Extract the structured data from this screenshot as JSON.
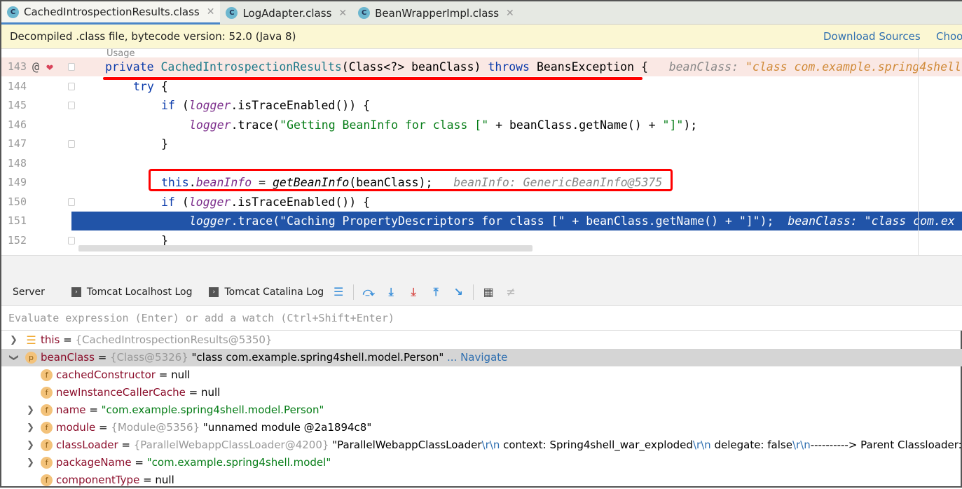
{
  "tabs": [
    {
      "label": "CachedIntrospectionResults.class",
      "active": true
    },
    {
      "label": "LogAdapter.class"
    },
    {
      "label": "BeanWrapperImpl.class"
    }
  ],
  "banner": {
    "text": "Decompiled .class file, bytecode version: 52.0 (Java 8)",
    "download_sources": "Download Sources",
    "choose": "Choo"
  },
  "usage_hint": "Usage",
  "code": [
    {
      "n": "143",
      "indent": 0,
      "hl": true,
      "tokens": [
        [
          "kw",
          "private "
        ],
        [
          "fn",
          "CachedIntrospectionResults"
        ],
        [
          "",
          "(Class<?> beanClass) "
        ],
        [
          "kw",
          "throws "
        ],
        [
          "",
          "BeansException {"
        ],
        [
          "hint",
          "   beanClass: "
        ],
        [
          "hintv",
          "\"class com.example.spring4shell"
        ]
      ]
    },
    {
      "n": "144",
      "indent": 1,
      "tokens": [
        [
          "kw",
          "try "
        ],
        [
          "",
          "{"
        ]
      ]
    },
    {
      "n": "145",
      "indent": 2,
      "tokens": [
        [
          "kw",
          "if "
        ],
        [
          "",
          "("
        ],
        [
          "lg",
          "logger"
        ],
        [
          "",
          ".isTraceEnabled()) {"
        ]
      ]
    },
    {
      "n": "146",
      "indent": 3,
      "tokens": [
        [
          "lg",
          "logger"
        ],
        [
          "",
          ".trace("
        ],
        [
          "str",
          "\"Getting BeanInfo for class [\""
        ],
        [
          "",
          " + beanClass.getName() + "
        ],
        [
          "str",
          "\"]\""
        ],
        [
          "",
          ");"
        ]
      ]
    },
    {
      "n": "147",
      "indent": 2,
      "tokens": [
        [
          "",
          "}"
        ]
      ]
    },
    {
      "n": "148",
      "indent": 0,
      "tokens": []
    },
    {
      "n": "149",
      "indent": 2,
      "tokens": [
        [
          "kw",
          "this"
        ],
        [
          "",
          "."
        ],
        [
          "lg",
          "beanInfo"
        ],
        [
          "",
          " = "
        ],
        [
          "it",
          "getBeanInfo"
        ],
        [
          "",
          "(beanClass);"
        ],
        [
          "hint",
          "   beanInfo: GenericBeanInfo@5375"
        ]
      ]
    },
    {
      "n": "150",
      "indent": 2,
      "tokens": [
        [
          "kw",
          "if "
        ],
        [
          "",
          "("
        ],
        [
          "lg",
          "logger"
        ],
        [
          "",
          ".isTraceEnabled()) {"
        ]
      ]
    },
    {
      "n": "151",
      "indent": 3,
      "sel": true,
      "tokens": [
        [
          "lg",
          "logger"
        ],
        [
          "",
          ".trace("
        ],
        [
          "str",
          "\"Caching PropertyDescriptors for class [\""
        ],
        [
          "",
          " + beanClass.getName() + "
        ],
        [
          "str",
          "\"]\""
        ],
        [
          "",
          ");"
        ],
        [
          "hint",
          "  beanClass: \"class com.ex"
        ]
      ]
    },
    {
      "n": "152",
      "indent": 2,
      "tokens": [
        [
          "",
          "}"
        ]
      ]
    }
  ],
  "toolbar": {
    "server": "Server",
    "localhost_log": "Tomcat Localhost Log",
    "catalina_log": "Tomcat Catalina Log"
  },
  "eval_placeholder": "Evaluate expression (Enter) or add a watch (Ctrl+Shift+Enter)",
  "variables": [
    {
      "level": 0,
      "arrow": "›",
      "icon": "list",
      "name": "this",
      "parts": [
        [
          "gr",
          "{CachedIntrospectionResults@5350}"
        ]
      ]
    },
    {
      "level": 0,
      "arrow": "⌄",
      "icon": "p",
      "name": "beanClass",
      "selected": true,
      "parts": [
        [
          "gr",
          "{Class@5326} "
        ],
        [
          "",
          "\"class com.example.spring4shell.model.Person\""
        ],
        [
          "bl",
          " ... Navigate"
        ]
      ]
    },
    {
      "level": 1,
      "arrow": "",
      "icon": "f",
      "name": "cachedConstructor",
      "parts": [
        [
          "",
          "null"
        ]
      ]
    },
    {
      "level": 1,
      "arrow": "",
      "icon": "f",
      "name": "newInstanceCallerCache",
      "parts": [
        [
          "",
          "null"
        ]
      ]
    },
    {
      "level": 1,
      "arrow": "›",
      "icon": "f",
      "name": "name",
      "parts": [
        [
          "gs",
          "\"com.example.spring4shell.model.Person\""
        ]
      ]
    },
    {
      "level": 1,
      "arrow": "›",
      "icon": "f",
      "name": "module",
      "parts": [
        [
          "gr",
          "{Module@5356} "
        ],
        [
          "",
          "\"unnamed module @2a1894c8\""
        ]
      ]
    },
    {
      "level": 1,
      "arrow": "›",
      "icon": "f",
      "name": "classLoader",
      "parts": [
        [
          "gr",
          "{ParallelWebappClassLoader@4200} "
        ],
        [
          "",
          "\"ParallelWebappClassLoader"
        ],
        [
          "esc",
          "\\r\\n"
        ],
        [
          "",
          "  context: Spring4shell_war_exploded"
        ],
        [
          "esc",
          "\\r\\n"
        ],
        [
          "",
          "  delegate: false"
        ],
        [
          "esc",
          "\\r\\n"
        ],
        [
          "",
          "----------> Parent Classloader:"
        ],
        [
          "esc",
          "\\r\\n"
        ],
        [
          "",
          "j"
        ]
      ]
    },
    {
      "level": 1,
      "arrow": "›",
      "icon": "f",
      "name": "packageName",
      "parts": [
        [
          "gs",
          "\"com.example.spring4shell.model\""
        ]
      ]
    },
    {
      "level": 1,
      "arrow": "",
      "icon": "f",
      "name": "componentType",
      "parts": [
        [
          "",
          "null"
        ]
      ]
    }
  ]
}
